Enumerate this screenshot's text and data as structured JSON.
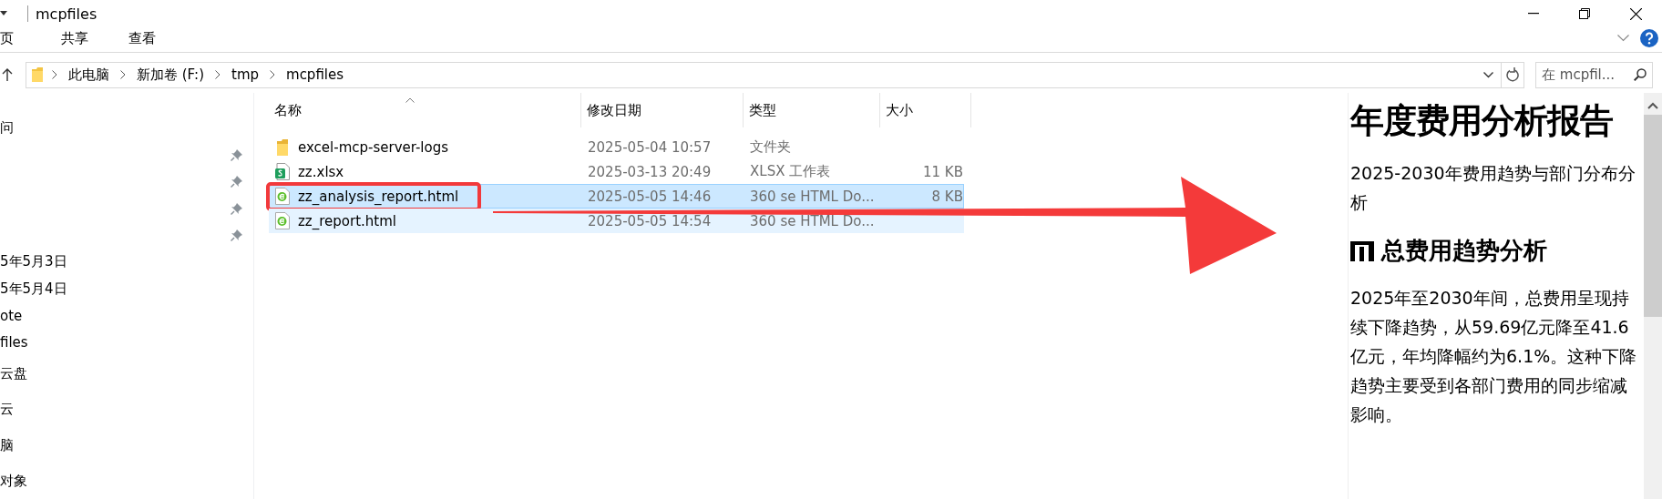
{
  "window": {
    "title": "mcpfiles"
  },
  "ribbon": {
    "tabs": [
      {
        "label": "页",
        "selected": false
      },
      {
        "label": "共享",
        "selected": false
      },
      {
        "label": "查看",
        "selected": false
      }
    ]
  },
  "address": {
    "path": [
      "此电脑",
      "新加卷 (F:)",
      "tmp",
      "mcpfiles"
    ]
  },
  "search": {
    "placeholder": "在 mcpfil..."
  },
  "sidebar": {
    "items": [
      {
        "label": "问"
      },
      {
        "pinned": true
      },
      {
        "pinned": true
      },
      {
        "pinned": true
      },
      {
        "pinned": true
      },
      {
        "label": "5年5月3日"
      },
      {
        "label": "5年5月4日"
      },
      {
        "label": "ote"
      },
      {
        "label": "files"
      },
      {
        "label": "云盘"
      },
      {
        "label": "云"
      },
      {
        "label": "脑"
      },
      {
        "label": "对象"
      }
    ]
  },
  "table": {
    "columns": [
      {
        "label": "名称",
        "sorted": true
      },
      {
        "label": "修改日期",
        "sorted": false
      },
      {
        "label": "类型",
        "sorted": false
      },
      {
        "label": "大小",
        "sorted": false
      }
    ],
    "rows": [
      {
        "kind": "folder",
        "name": "excel-mcp-server-logs",
        "date": "2025-05-04 10:57",
        "type": "文件夹",
        "selected": false,
        "focused": false,
        "annotated": false
      },
      {
        "kind": "sheet",
        "name": "zz.xlsx",
        "date": "2025-03-13 20:49",
        "type": "XLSX 工作表",
        "size": "11 KB",
        "selected": false,
        "focused": false,
        "annotated": false
      },
      {
        "kind": "web",
        "name": "zz_analysis_report.html",
        "date": "2025-05-05 14:46",
        "type": "360 se HTML Do...",
        "size": "8 KB",
        "selected": true,
        "focused": true,
        "annotated": true
      },
      {
        "kind": "web",
        "name": "zz_report.html",
        "date": "2025-05-05 14:54",
        "type": "360 se HTML Do...",
        "selected": true,
        "focused": false,
        "annotated": false
      }
    ]
  },
  "preview": {
    "title": "年度费用分析报告",
    "subtitle": "2025-2030年费用趋势与部门分布分析",
    "heading": "总费用趋势分析",
    "paragraph": "2025年至2030年间，总费用呈现持续下降趋势，从59.69亿元降至41.6亿元，年均降幅约为6.1%。这种下降趋势主要受到各部门费用的同步缩减影响。"
  }
}
